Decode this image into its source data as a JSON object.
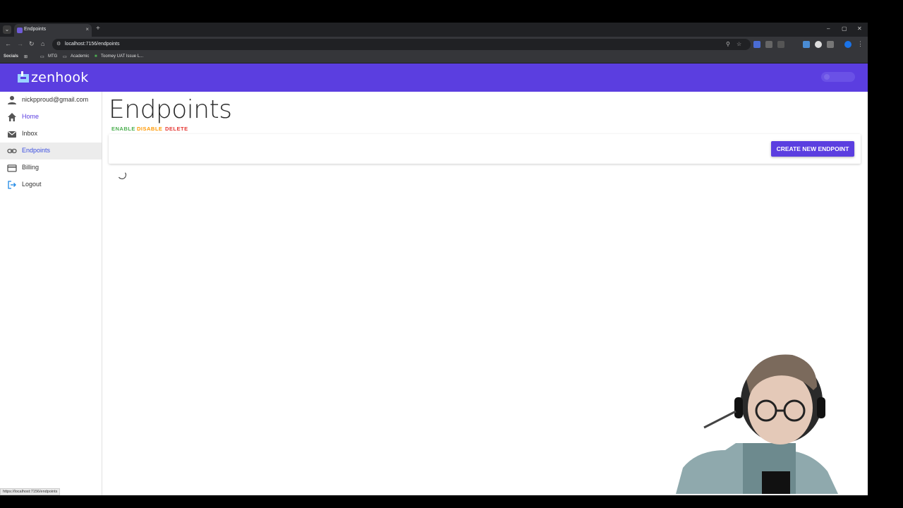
{
  "browser": {
    "tab_title": "Endpoints",
    "tab_close": "×",
    "new_tab": "+",
    "tab_menu": "⌄",
    "url": "localhost:7156/endpoints",
    "win_minimize": "–",
    "win_maximize": "▢",
    "win_close": "✕",
    "bookmarks": [
      "Socials",
      "MTG",
      "Academic",
      "Toomey UAT Issue L..."
    ],
    "status_url": "https://localhost:7156/endpoints"
  },
  "app": {
    "logo_text": "zenhook"
  },
  "sidebar": {
    "user_email": "nickpproud@gmail.com",
    "items": [
      {
        "label": "Home",
        "icon": "home-icon"
      },
      {
        "label": "Inbox",
        "icon": "mail-icon"
      },
      {
        "label": "Endpoints",
        "icon": "link-icon"
      },
      {
        "label": "Billing",
        "icon": "credit-card-icon"
      },
      {
        "label": "Logout",
        "icon": "logout-icon"
      }
    ]
  },
  "main": {
    "title": "Endpoints",
    "actions": {
      "enable": "ENABLE",
      "disable": "DISABLE",
      "delete": "DELETE"
    },
    "create_button": "CREATE NEW ENDPOINT"
  },
  "colors": {
    "brand": "#5b3ee0",
    "enable": "#4caf50",
    "disable": "#ff9800",
    "delete": "#e53935"
  }
}
